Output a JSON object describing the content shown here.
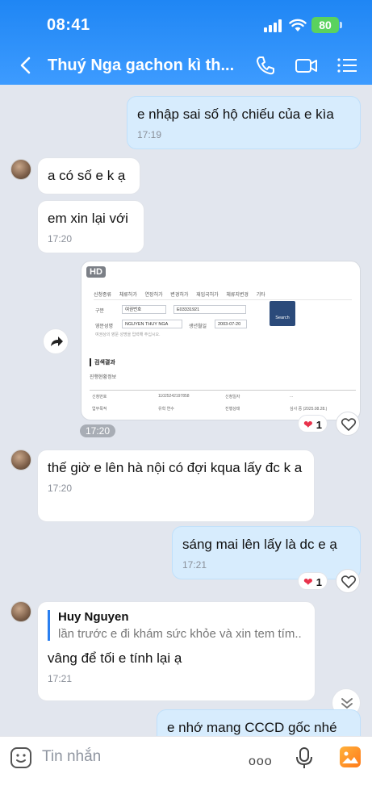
{
  "status_bar": {
    "time": "08:41",
    "battery": "80"
  },
  "header": {
    "title": "Thuý Nga gachon kì th..."
  },
  "messages": [
    {
      "text": "e nhập sai số hộ chiếu của e kìa",
      "time": "17:19"
    },
    {
      "text": "a có số e k ạ"
    },
    {
      "text": "em xin lại với",
      "time": "17:20"
    },
    {
      "time": "17:20",
      "reaction_count": "1"
    },
    {
      "text": "thế giờ e lên hà nội có đợi kqua lấy đc k a",
      "time": "17:20"
    },
    {
      "text": "sáng mai lên lấy là dc e ạ",
      "time": "17:21",
      "reaction_count": "1"
    },
    {
      "quote_name": "Huy Nguyen",
      "quote_text": "lần trước e đi khám sức khỏe và xin tem tím...",
      "text": "vâng để tối e tính lại ạ",
      "time": "17:21"
    },
    {
      "text": "e nhớ mang CCCD gốc nhé"
    }
  ],
  "image": {
    "badge": "HD",
    "row1": [
      "신청종류",
      "체류허가",
      "연장허가",
      "변경허가",
      "재입국허가",
      "체류지변경",
      "기타"
    ],
    "label_kind": "구분",
    "kind_value": "여권번호",
    "passport_value": "E03331921",
    "label_name": "영문성명",
    "name_value": "NGUYEN THUY NGA",
    "label_birth": "생년월일",
    "birth_value": "2003-07-20",
    "note": "여권상의 영문 성명을 입력해 주십시오.",
    "search_label": "Search",
    "result_title": "검색결과",
    "result_sub": "진행현황정보",
    "tbl_h1": "신청번호",
    "tbl_v1": "11025242197858",
    "tbl_h2": "신청일자",
    "tbl_v2": "...",
    "tbl_h3": "업무목적",
    "tbl_v3": "유학 연수",
    "tbl_h4": "진행상태",
    "tbl_v4": "심사 중 (2025.08.28.)"
  },
  "composer": {
    "placeholder": "Tin nhắn",
    "more": "ooo"
  }
}
